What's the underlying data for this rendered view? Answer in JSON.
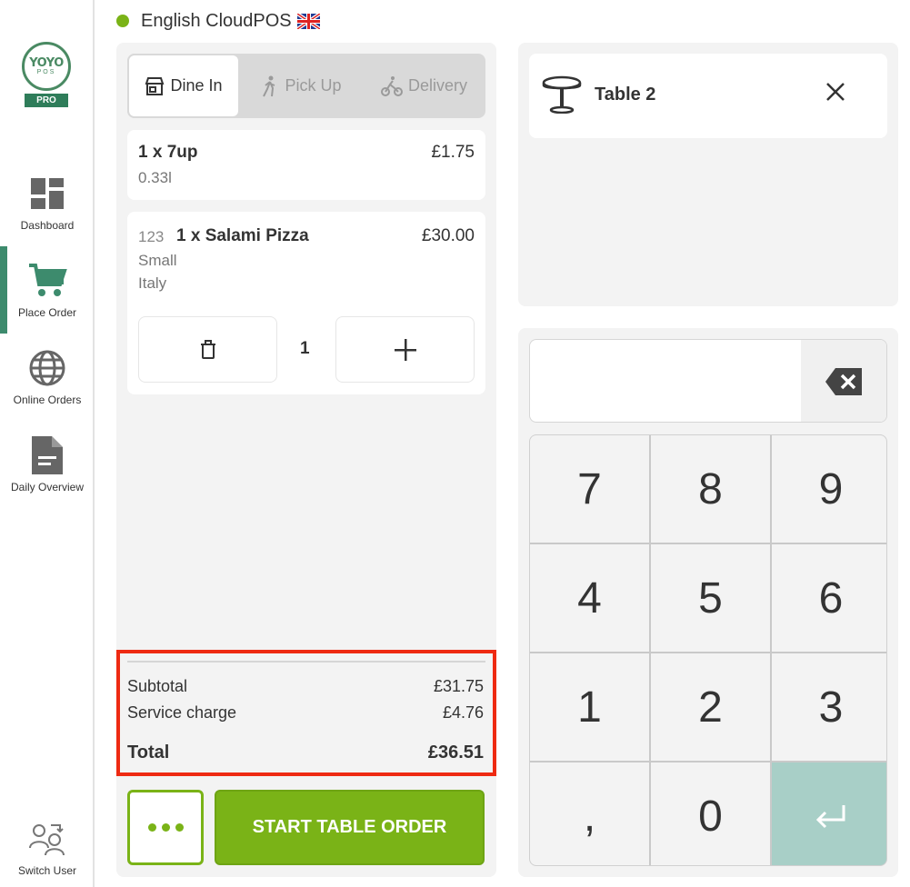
{
  "header": {
    "title": "English CloudPOS",
    "flag": "uk-flag-icon"
  },
  "logo": {
    "brand": "YOYO",
    "sub": "POS",
    "badge": "PRO"
  },
  "sidebar": {
    "items": [
      {
        "label": "Dashboard",
        "icon": "dashboard-icon"
      },
      {
        "label": "Place Order",
        "icon": "cart-icon",
        "active": true
      },
      {
        "label": "Online Orders",
        "icon": "globe-icon"
      },
      {
        "label": "Daily Overview",
        "icon": "document-icon"
      }
    ],
    "switch_user": {
      "label": "Switch User",
      "icon": "switch-user-icon"
    }
  },
  "order_type": {
    "options": [
      {
        "label": "Dine In",
        "icon": "store-icon",
        "active": true
      },
      {
        "label": "Pick Up",
        "icon": "walking-icon"
      },
      {
        "label": "Delivery",
        "icon": "bicycle-icon"
      }
    ]
  },
  "items": [
    {
      "name": "1 x 7up",
      "price": "£1.75",
      "details": [
        "0.33l"
      ]
    },
    {
      "code": "123",
      "name": "1 x Salami Pizza",
      "price": "£30.00",
      "details": [
        "Small",
        "Italy"
      ],
      "quantity": "1"
    }
  ],
  "totals": {
    "subtotal_label": "Subtotal",
    "subtotal": "£31.75",
    "service_label": "Service charge",
    "service": "£4.76",
    "total_label": "Total",
    "total": "£36.51"
  },
  "actions": {
    "start_label": "START TABLE ORDER"
  },
  "table": {
    "name": "Table 2"
  },
  "keypad": {
    "input_value": "",
    "keys": [
      "7",
      "8",
      "9",
      "4",
      "5",
      "6",
      "1",
      "2",
      "3",
      ",",
      "0"
    ]
  },
  "colors": {
    "accent": "#7ab317",
    "brand": "#3d8b6d",
    "highlight": "#ee2a12",
    "enter": "#a8cfc7"
  }
}
